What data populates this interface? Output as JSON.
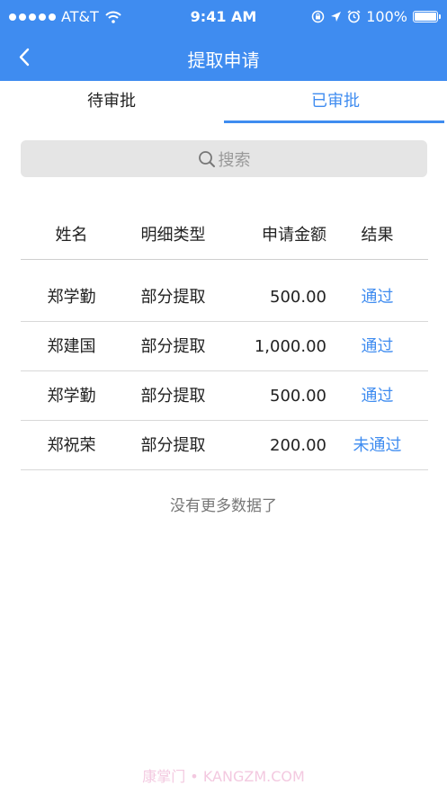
{
  "status_bar": {
    "carrier": "AT&T",
    "time": "9:41 AM",
    "battery": "100%"
  },
  "nav": {
    "title": "提取申请"
  },
  "tabs": [
    {
      "label": "待审批",
      "active": false
    },
    {
      "label": "已审批",
      "active": true
    }
  ],
  "search": {
    "placeholder": "搜索"
  },
  "table": {
    "headers": {
      "name": "姓名",
      "type": "明细类型",
      "amount": "申请金额",
      "result": "结果"
    },
    "rows": [
      {
        "name": "郑学勤",
        "type": "部分提取",
        "amount": "500.00",
        "result": "通过"
      },
      {
        "name": "郑建国",
        "type": "部分提取",
        "amount": "1,000.00",
        "result": "通过"
      },
      {
        "name": "郑学勤",
        "type": "部分提取",
        "amount": "500.00",
        "result": "通过"
      },
      {
        "name": "郑祝荣",
        "type": "部分提取",
        "amount": "200.00",
        "result": "未通过"
      }
    ]
  },
  "footer": {
    "no_more": "没有更多数据了",
    "watermark": "康掌门 • KANGZM.COM"
  },
  "colors": {
    "accent": "#3f8cf0",
    "search_bg": "#e5e5e5"
  }
}
